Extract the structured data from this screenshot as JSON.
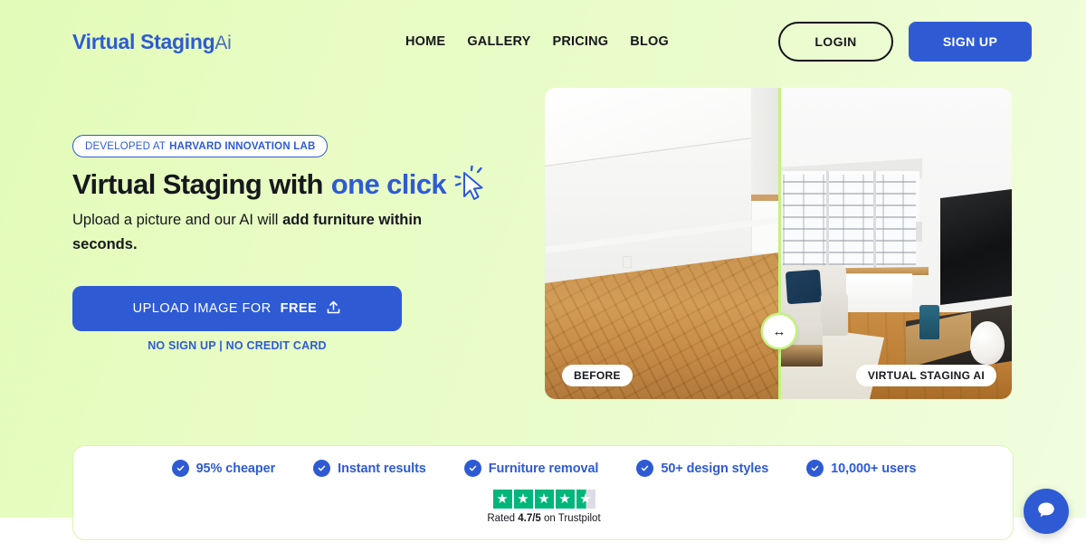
{
  "brand": {
    "name": "Virtual Staging",
    "suffix": "Ai"
  },
  "nav": {
    "items": [
      {
        "label": "HOME"
      },
      {
        "label": "GALLERY"
      },
      {
        "label": "PRICING"
      },
      {
        "label": "BLOG"
      }
    ],
    "login_label": "LOGIN",
    "signup_label": "SIGN UP"
  },
  "hero": {
    "badge_prefix": "DEVELOPED AT",
    "badge_strong": "HARVARD INNOVATION LAB",
    "headline_plain": "Virtual Staging with",
    "headline_accent": "one click",
    "sub_plain": "Upload a picture and our AI will ",
    "sub_strong": "add furniture within seconds.",
    "cta_plain": "UPLOAD IMAGE FOR",
    "cta_strong": "FREE",
    "cta_note": "NO SIGN UP | NO CREDIT CARD"
  },
  "comparison": {
    "before_label": "BEFORE",
    "after_label": "VIRTUAL STAGING AI",
    "handle_glyph": "↔"
  },
  "features": [
    {
      "label": "95% cheaper"
    },
    {
      "label": "Instant results"
    },
    {
      "label": "Furniture removal"
    },
    {
      "label": "50+ design styles"
    },
    {
      "label": "10,000+ users"
    }
  ],
  "trustpilot": {
    "stars_total": 5,
    "stars_filled": 4,
    "has_half_star": true,
    "rated_prefix": "Rated ",
    "score": "4.7/5",
    "rated_suffix": " on Trustpilot"
  },
  "chat": {
    "tooltip": "chat"
  },
  "colors": {
    "accent_blue": "#2e5bd4",
    "bg_green": "#e6fbc0",
    "trust_green": "#00b67a",
    "text_dark": "#16181d"
  }
}
